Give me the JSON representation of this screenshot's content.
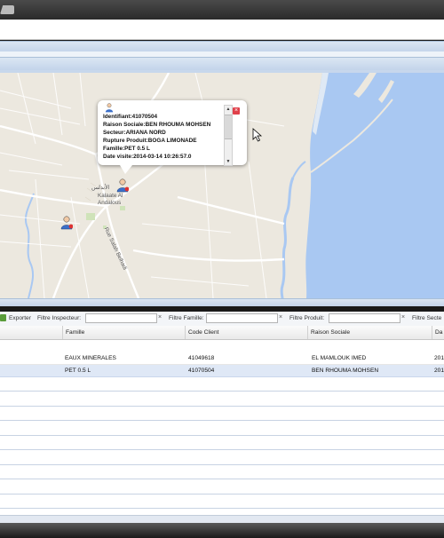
{
  "popup": {
    "lines": [
      "Identifiant:41070504",
      "Raison Sociale:BEN RHOUMA MOHSEN",
      "Secteur:ARIANA NORD",
      "Rupture Produit:BOGA LIMONADE",
      "Famille:PET 0.5 L",
      "Date visite:2014-03-14 10:26:57.0"
    ],
    "close": "×",
    "scroll_up": "▲",
    "scroll_down": "▼"
  },
  "map": {
    "town_label_ar": "الأندلس",
    "town_label_1": "Kalaate Al",
    "town_label_2": "Andalous",
    "street_label": "Rue Salah Belhadi",
    "colors": {
      "land": "#ece8df",
      "water": "#a9c8f2",
      "road": "#ffffff",
      "park": "#cfe3b9"
    }
  },
  "toolbar": {
    "export": "Exporter",
    "filtre_inspecteur": "Filtre Inspecteur:",
    "filtre_famille": "Filtre Famille:",
    "filtre_produit": "Filtre Produit:",
    "filtre_secteur": "Filtre Secte",
    "clear": "×"
  },
  "grid": {
    "columns": [
      "Famille",
      "Code Client",
      "Raison Sociale",
      "Da"
    ],
    "rows": [
      {
        "famille": "EAUX MINERALES",
        "code": "41049618",
        "raison": "EL MAMLOUK IMED",
        "date": "201"
      },
      {
        "famille": "PET 0.5 L",
        "code": "41070504",
        "raison": "BEN RHOUMA MOHSEN",
        "date": "201"
      }
    ]
  }
}
